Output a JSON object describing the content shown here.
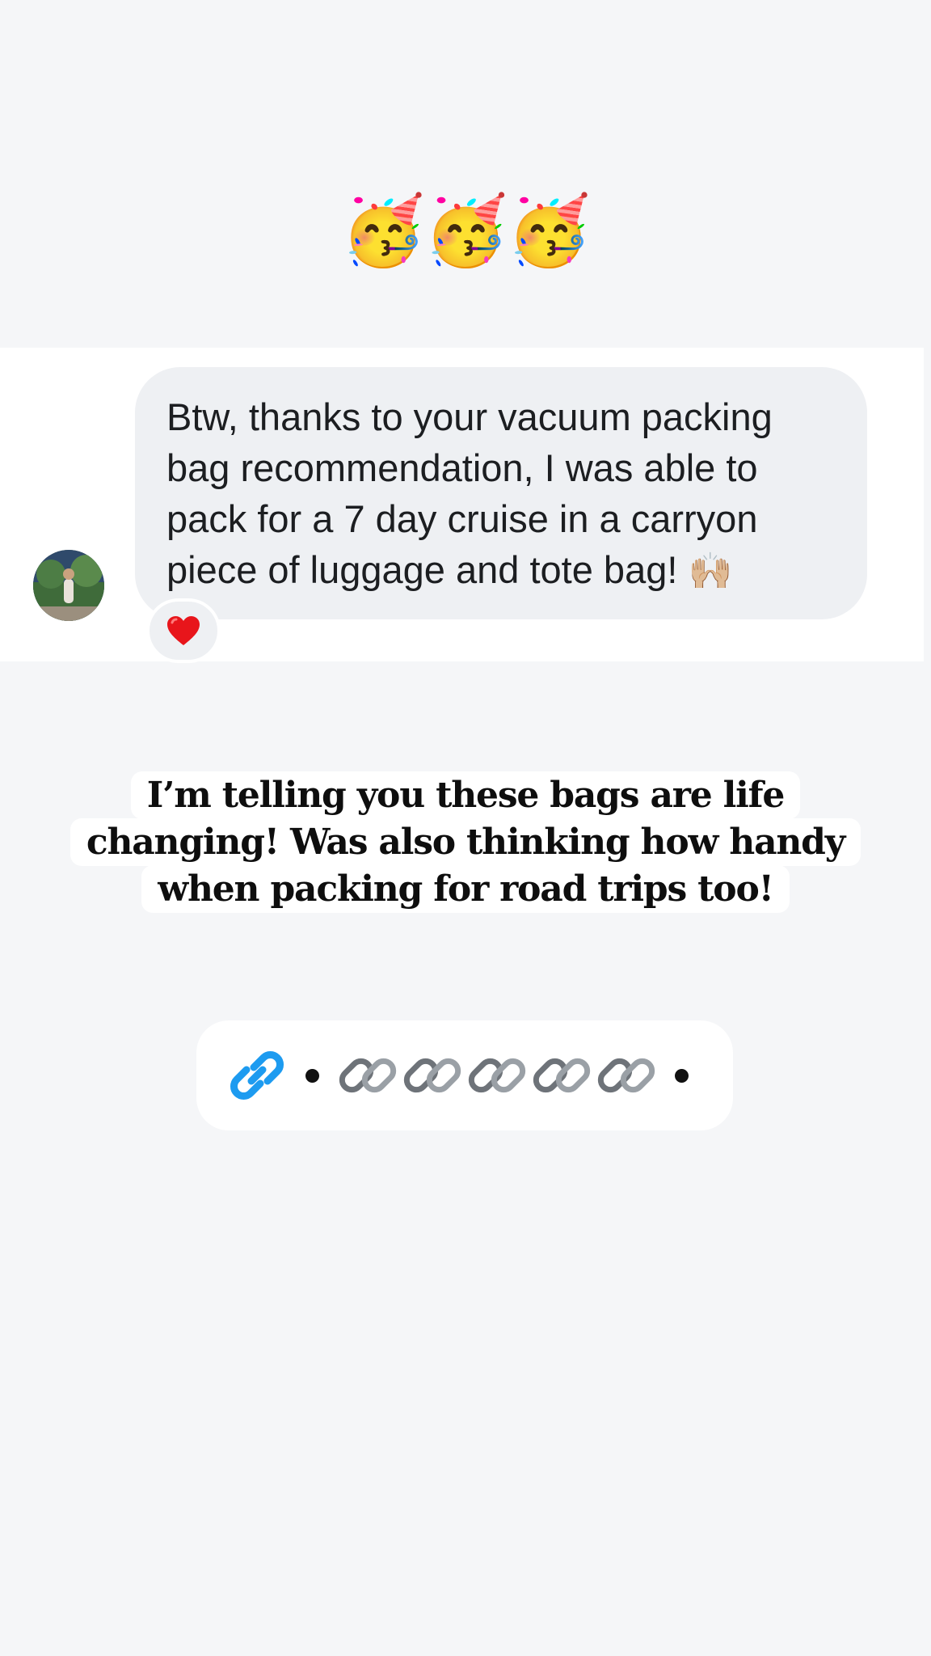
{
  "top_emojis": "🥳🥳🥳",
  "message": {
    "text": "Btw, thanks to your vacuum packing\nbag recommendation, I was able to\npack for a 7 day cruise in a carryon\npiece of luggage and tote bag! ",
    "emoji": "🙌🏼",
    "reaction": "❤️"
  },
  "caption": {
    "line1": "I’m telling you these bags are life",
    "line2": "changing! Was also thinking how handy",
    "line3": "when packing for road trips too!"
  },
  "link_sticker": {
    "icons": [
      "link-icon",
      "chain-icon"
    ],
    "accent": "#1d9bf0"
  }
}
